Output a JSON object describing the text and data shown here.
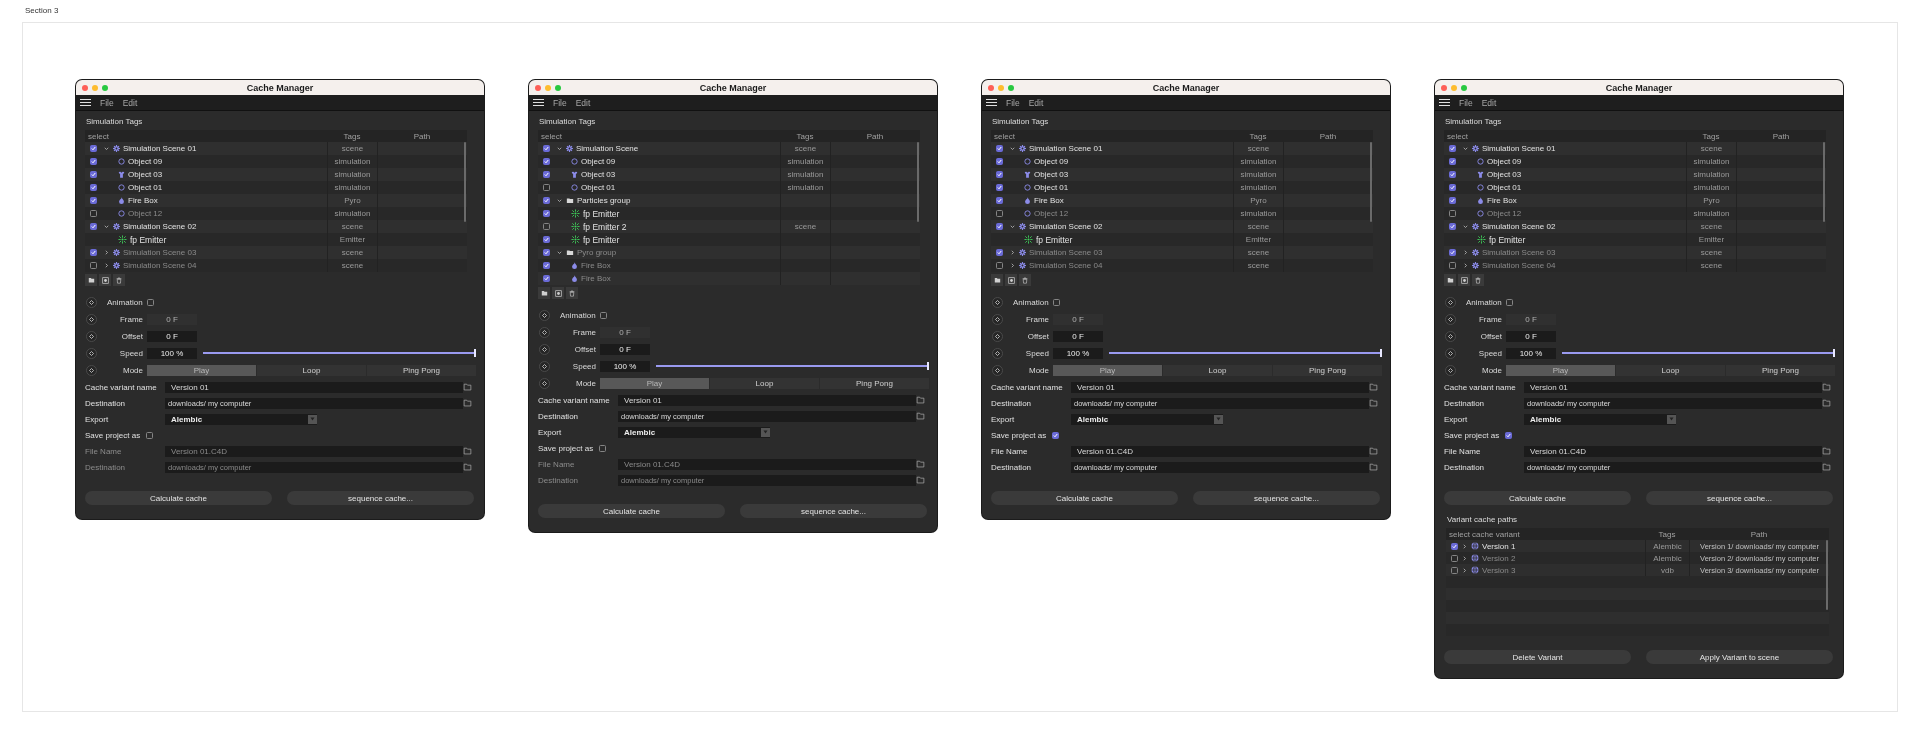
{
  "section_label": "Section 3",
  "windows": [
    {
      "title": "Cache Manager",
      "menu": [
        "File",
        "Edit"
      ],
      "tags_panel": {
        "title": "Simulation Tags",
        "columns": [
          "select",
          "Tags",
          "Path"
        ],
        "items": [
          {
            "label": "Simulation Scene 01",
            "kind": "scene",
            "tag": "scene",
            "checked": true,
            "expanded": true,
            "dimmed": false,
            "children": [
              {
                "label": "Object 09",
                "kind": "sphere",
                "tag": "simulation",
                "checked": true,
                "dimmed": false
              },
              {
                "label": "Object 03",
                "kind": "shirt",
                "tag": "simulation",
                "checked": true,
                "dimmed": false
              },
              {
                "label": "Object 01",
                "kind": "sphere",
                "tag": "simulation",
                "checked": true,
                "dimmed": false
              },
              {
                "label": "Fire Box",
                "kind": "fire",
                "tag": "Pyro",
                "checked": true,
                "dimmed": false
              },
              {
                "label": "Object 12",
                "kind": "sphere",
                "tag": "simulation",
                "checked": false,
                "dimmed": true
              }
            ]
          },
          {
            "label": "Simulation Scene 02",
            "kind": "scene",
            "tag": "scene",
            "checked": true,
            "expanded": true,
            "dimmed": false,
            "children": [
              {
                "label": "fp Emitter",
                "kind": "emitter",
                "tag": "Emitter",
                "dimmed": false
              }
            ]
          },
          {
            "label": "Simulation Scene 03",
            "kind": "scene",
            "tag": "scene",
            "checked": true,
            "expanded": false,
            "dimmed": true
          },
          {
            "label": "Simulation Scene 04",
            "kind": "scene",
            "tag": "scene",
            "checked": false,
            "expanded": false,
            "dimmed": true
          }
        ]
      },
      "animation": {
        "label": "Animation",
        "checked": false,
        "fields": [
          {
            "label": "Frame",
            "value": "0 F",
            "disabled": true
          },
          {
            "label": "Offset",
            "value": "0 F",
            "disabled": false
          },
          {
            "label": "Speed",
            "value": "100 %",
            "disabled": false,
            "level": 1
          }
        ],
        "mode": {
          "label": "Mode",
          "options": [
            {
              "label": "Play",
              "selected": true
            },
            {
              "label": "Loop",
              "selected": false
            },
            {
              "label": "Ping Pong",
              "selected": false
            }
          ]
        }
      },
      "form": {
        "variant_name": {
          "label": "Cache variant name",
          "value": "Version 01"
        },
        "destination": {
          "label": "Destination",
          "value": "downloads/ my computer"
        },
        "export": {
          "label": "Export",
          "value": "Alembic"
        },
        "save_project": {
          "label": "Save project as",
          "checked": false
        },
        "file_name": {
          "label": "File Name",
          "value": "Version 01.C4D"
        },
        "file_destination": {
          "label": "Destination",
          "value": "downloads/ my computer"
        }
      },
      "buttons": [
        "Calculate cache",
        "sequence cache..."
      ]
    },
    {
      "title": "Cache Manager",
      "menu": [
        "File",
        "Edit"
      ],
      "tags_panel": {
        "title": "Simulation Tags",
        "columns": [
          "select",
          "Tags",
          "Path"
        ],
        "items": [
          {
            "label": "Simulation Scene",
            "kind": "scene",
            "tag": "scene",
            "checked": true,
            "expanded": true,
            "dimmed": false,
            "children": [
              {
                "label": "Object 09",
                "kind": "sphere",
                "tag": "simulation",
                "checked": true,
                "dimmed": false
              },
              {
                "label": "Object 03",
                "kind": "shirt",
                "tag": "simulation",
                "checked": true,
                "dimmed": false
              },
              {
                "label": "Object 01",
                "kind": "sphere",
                "tag": "simulation",
                "checked": false,
                "dimmed": false
              }
            ]
          },
          {
            "label": "Particles group",
            "kind": "folder",
            "checked": true,
            "expanded": true,
            "dimmed": false,
            "children": [
              {
                "label": "fp Emitter",
                "kind": "emitter",
                "checked": true,
                "dimmed": false
              },
              {
                "label": "fp Emitter 2",
                "kind": "emitter",
                "tag": "scene",
                "checked": false,
                "dimmed": false
              },
              {
                "label": "fp Emitter",
                "kind": "emitter",
                "checked": true,
                "dimmed": false
              }
            ]
          },
          {
            "label": "Pyro group",
            "kind": "folder",
            "checked": true,
            "expanded": true,
            "dimmed": true,
            "children": [
              {
                "label": "Fire Box",
                "kind": "fire",
                "checked": true,
                "dimmed": true
              },
              {
                "label": "Fire Box",
                "kind": "fire",
                "checked": true,
                "dimmed": true
              }
            ]
          }
        ]
      },
      "animation": {
        "label": "Animation",
        "checked": false,
        "fields": [
          {
            "label": "Frame",
            "value": "0 F",
            "disabled": true
          },
          {
            "label": "Offset",
            "value": "0 F",
            "disabled": false
          },
          {
            "label": "Speed",
            "value": "100 %",
            "disabled": false,
            "level": 1
          }
        ],
        "mode": {
          "label": "Mode",
          "options": [
            {
              "label": "Play",
              "selected": true
            },
            {
              "label": "Loop",
              "selected": false
            },
            {
              "label": "Ping Pong",
              "selected": false
            }
          ]
        }
      },
      "form": {
        "variant_name": {
          "label": "Cache variant name",
          "value": "Version 01"
        },
        "destination": {
          "label": "Destination",
          "value": "downloads/ my computer"
        },
        "export": {
          "label": "Export",
          "value": "Alembic"
        },
        "save_project": {
          "label": "Save project as",
          "checked": false
        },
        "file_name": {
          "label": "File Name",
          "value": "Version 01.C4D"
        },
        "file_destination": {
          "label": "Destination",
          "value": "downloads/ my computer"
        }
      },
      "buttons": [
        "Calculate cache",
        "sequence cache..."
      ]
    },
    {
      "title": "Cache Manager",
      "menu": [
        "File",
        "Edit"
      ],
      "tags_panel": {
        "title": "Simulation Tags",
        "columns": [
          "select",
          "Tags",
          "Path"
        ],
        "items": [
          {
            "label": "Simulation Scene 01",
            "kind": "scene",
            "tag": "scene",
            "checked": true,
            "expanded": true,
            "dimmed": false,
            "children": [
              {
                "label": "Object 09",
                "kind": "sphere",
                "tag": "simulation",
                "checked": true,
                "dimmed": false
              },
              {
                "label": "Object 03",
                "kind": "shirt",
                "tag": "simulation",
                "checked": true,
                "dimmed": false
              },
              {
                "label": "Object 01",
                "kind": "sphere",
                "tag": "simulation",
                "checked": true,
                "dimmed": false
              },
              {
                "label": "Fire Box",
                "kind": "fire",
                "tag": "Pyro",
                "checked": true,
                "dimmed": false
              },
              {
                "label": "Object 12",
                "kind": "sphere",
                "tag": "simulation",
                "checked": false,
                "dimmed": true
              }
            ]
          },
          {
            "label": "Simulation Scene 02",
            "kind": "scene",
            "tag": "scene",
            "checked": true,
            "expanded": true,
            "dimmed": false,
            "children": [
              {
                "label": "fp Emitter",
                "kind": "emitter",
                "tag": "Emitter",
                "dimmed": false
              }
            ]
          },
          {
            "label": "Simulation Scene 03",
            "kind": "scene",
            "tag": "scene",
            "checked": true,
            "expanded": false,
            "dimmed": true
          },
          {
            "label": "Simulation Scene 04",
            "kind": "scene",
            "tag": "scene",
            "checked": false,
            "expanded": false,
            "dimmed": true
          }
        ]
      },
      "animation": {
        "label": "Animation",
        "checked": false,
        "fields": [
          {
            "label": "Frame",
            "value": "0 F",
            "disabled": true
          },
          {
            "label": "Offset",
            "value": "0 F",
            "disabled": false
          },
          {
            "label": "Speed",
            "value": "100 %",
            "disabled": false,
            "level": 1
          }
        ],
        "mode": {
          "label": "Mode",
          "options": [
            {
              "label": "Play",
              "selected": true
            },
            {
              "label": "Loop",
              "selected": false
            },
            {
              "label": "Ping Pong",
              "selected": false
            }
          ]
        }
      },
      "form": {
        "variant_name": {
          "label": "Cache variant name",
          "value": "Version 01"
        },
        "destination": {
          "label": "Destination",
          "value": "downloads/ my computer"
        },
        "export": {
          "label": "Export",
          "value": "Alembic"
        },
        "save_project": {
          "label": "Save project as",
          "checked": true
        },
        "file_name": {
          "label": "File Name",
          "value": "Version 01.C4D"
        },
        "file_destination": {
          "label": "Destination",
          "value": "downloads/ my computer"
        }
      },
      "buttons": [
        "Calculate cache",
        "sequence cache..."
      ]
    },
    {
      "title": "Cache Manager",
      "menu": [
        "File",
        "Edit"
      ],
      "tags_panel": {
        "title": "Simulation Tags",
        "columns": [
          "select",
          "Tags",
          "Path"
        ],
        "items": [
          {
            "label": "Simulation Scene 01",
            "kind": "scene",
            "tag": "scene",
            "checked": true,
            "expanded": true,
            "dimmed": false,
            "children": [
              {
                "label": "Object 09",
                "kind": "sphere",
                "tag": "simulation",
                "checked": true,
                "dimmed": false
              },
              {
                "label": "Object 03",
                "kind": "shirt",
                "tag": "simulation",
                "checked": true,
                "dimmed": false
              },
              {
                "label": "Object 01",
                "kind": "sphere",
                "tag": "simulation",
                "checked": true,
                "dimmed": false
              },
              {
                "label": "Fire Box",
                "kind": "fire",
                "tag": "Pyro",
                "checked": true,
                "dimmed": false
              },
              {
                "label": "Object 12",
                "kind": "sphere",
                "tag": "simulation",
                "checked": false,
                "dimmed": true
              }
            ]
          },
          {
            "label": "Simulation Scene 02",
            "kind": "scene",
            "tag": "scene",
            "checked": true,
            "expanded": true,
            "dimmed": false,
            "children": [
              {
                "label": "fp Emitter",
                "kind": "emitter",
                "tag": "Emitter",
                "dimmed": false
              }
            ]
          },
          {
            "label": "Simulation Scene 03",
            "kind": "scene",
            "tag": "scene",
            "checked": true,
            "expanded": false,
            "dimmed": true
          },
          {
            "label": "Simulation Scene 04",
            "kind": "scene",
            "tag": "scene",
            "checked": false,
            "expanded": false,
            "dimmed": true
          }
        ]
      },
      "animation": {
        "label": "Animation",
        "checked": false,
        "fields": [
          {
            "label": "Frame",
            "value": "0 F",
            "disabled": true
          },
          {
            "label": "Offset",
            "value": "0 F",
            "disabled": false
          },
          {
            "label": "Speed",
            "value": "100 %",
            "disabled": false,
            "level": 1
          }
        ],
        "mode": {
          "label": "Mode",
          "options": [
            {
              "label": "Play",
              "selected": true
            },
            {
              "label": "Loop",
              "selected": false
            },
            {
              "label": "Ping Pong",
              "selected": false
            }
          ]
        }
      },
      "form": {
        "variant_name": {
          "label": "Cache variant name",
          "value": "Version 01"
        },
        "destination": {
          "label": "Destination",
          "value": "downloads/ my computer"
        },
        "export": {
          "label": "Export",
          "value": "Alembic"
        },
        "save_project": {
          "label": "Save project as",
          "checked": true
        },
        "file_name": {
          "label": "File Name",
          "value": "Version 01.C4D"
        },
        "file_destination": {
          "label": "Destination",
          "value": "downloads/ my computer"
        }
      },
      "buttons": [
        "Calculate cache",
        "sequence cache..."
      ],
      "variants": {
        "title": "Variant cache paths",
        "columns": [
          "select cache variant",
          "Tags",
          "Path"
        ],
        "rows": [
          {
            "label": "Version 1",
            "tag": "Alembic",
            "path": "Version 1/ downloads/ my computer",
            "checked": true,
            "expanded": false,
            "dimmed": false
          },
          {
            "label": "Version 2",
            "tag": "Alembic",
            "path": "Version 2/ downloads/ my computer",
            "checked": false,
            "expanded": false,
            "dimmed": true
          },
          {
            "label": "Version 3",
            "tag": "vdb",
            "path": "Version 3/ downloads/ my computer",
            "checked": false,
            "expanded": false,
            "dimmed": true
          }
        ],
        "buttons": [
          "Delete Variant",
          "Apply Variant to scene"
        ]
      }
    }
  ]
}
